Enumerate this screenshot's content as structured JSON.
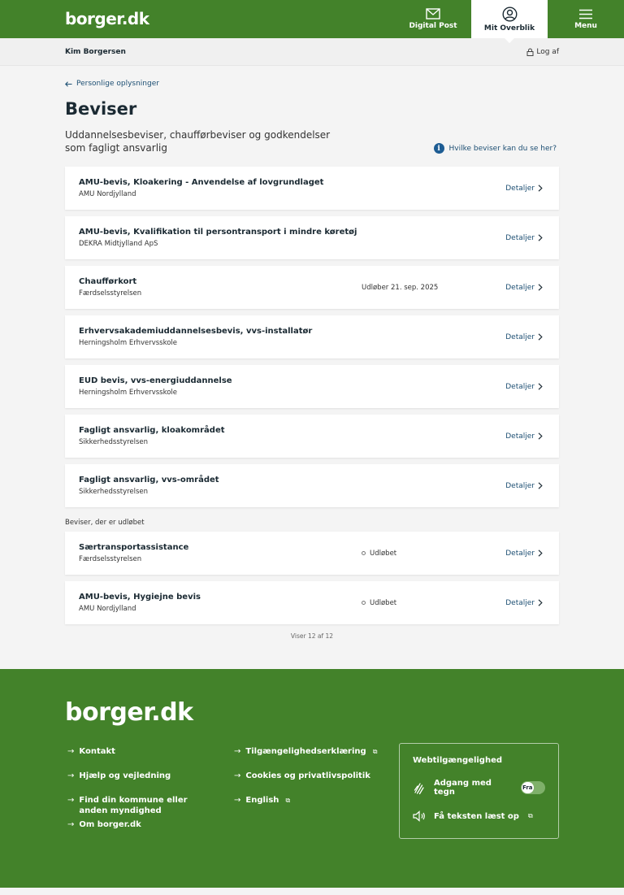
{
  "header": {
    "logo": "borger.dk",
    "nav": [
      {
        "label": "Digital Post",
        "icon": "envelope-icon"
      },
      {
        "label": "Mit Overblik",
        "icon": "user-circle-icon"
      },
      {
        "label": "Menu",
        "icon": "hamburger-icon"
      }
    ]
  },
  "userbar": {
    "name": "Kim Borgersen",
    "logout": "Log af"
  },
  "page": {
    "back": "Personlige oplysninger",
    "title": "Beviser",
    "intro": "Uddannelsesbeviser, chaufførbeviser og godkendelser som fagligt ansvarlig",
    "help": "Hvilke beviser kan du se her?"
  },
  "details_label": "Detaljer",
  "certificates": [
    {
      "title": "AMU-bevis, Kloakering - Anvendelse af lovgrundlaget",
      "issuer": "AMU Nordjylland",
      "status": ""
    },
    {
      "title": "AMU-bevis, Kvalifikation til persontransport i mindre køretøj",
      "issuer": "DEKRA Midtjylland ApS",
      "status": ""
    },
    {
      "title": "Chaufførkort",
      "issuer": "Færdselsstyrelsen",
      "status": "Udløber 21. sep. 2025"
    },
    {
      "title": "Erhvervsakademiuddannelsesbevis, vvs-installatør",
      "issuer": "Herningsholm Erhvervsskole",
      "status": ""
    },
    {
      "title": "EUD bevis, vvs-energiuddannelse",
      "issuer": "Herningsholm Erhvervsskole",
      "status": ""
    },
    {
      "title": "Fagligt ansvarlig, kloakområdet",
      "issuer": "Sikkerhedsstyrelsen",
      "status": ""
    },
    {
      "title": "Fagligt ansvarlig, vvs-området",
      "issuer": "Sikkerhedsstyrelsen",
      "status": ""
    }
  ],
  "expired_label": "Beviser, der er udløbet",
  "expired": [
    {
      "title": "Særtransportassistance",
      "issuer": "Færdselsstyrelsen",
      "status": "Udløbet"
    },
    {
      "title": "AMU-bevis, Hygiejne bevis",
      "issuer": "AMU Nordjylland",
      "status": "Udløbet"
    }
  ],
  "count": "Viser 12 af 12",
  "footer": {
    "logo": "borger.dk",
    "links_col1": [
      "Kontakt",
      "Hjælp og vejledning",
      "Find din kommune eller anden myndighed",
      "Om borger.dk"
    ],
    "links_col2": [
      "Tilgængelighedserklæring",
      "Cookies og privatlivspolitik",
      "English"
    ],
    "a11y": {
      "title": "Webtilgængelighed",
      "sign_language": "Adgang med tegn",
      "toggle_state": "Fra",
      "read_aloud": "Få teksten læst op"
    }
  }
}
